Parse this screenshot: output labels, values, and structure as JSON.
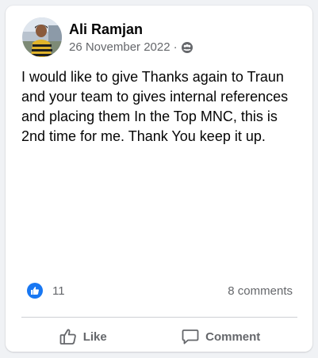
{
  "post": {
    "author": "Ali Ramjan",
    "date": "26 November 2022",
    "separator": "·",
    "audience_icon": "group-icon",
    "text": "I would like to give Thanks again to Traun and your team to gives internal references and placing them In the Top MNC, this is 2nd time for me. Thank You keep it up."
  },
  "stats": {
    "reaction_icon": "like-icon",
    "reaction_count": "11",
    "comments": "8 comments"
  },
  "actions": {
    "like_label": "Like",
    "comment_label": "Comment"
  },
  "colors": {
    "brand_blue": "#1877f2",
    "secondary_text": "#65676b",
    "primary_text": "#050505",
    "card_bg": "#ffffff",
    "page_bg": "#f0f2f5"
  }
}
